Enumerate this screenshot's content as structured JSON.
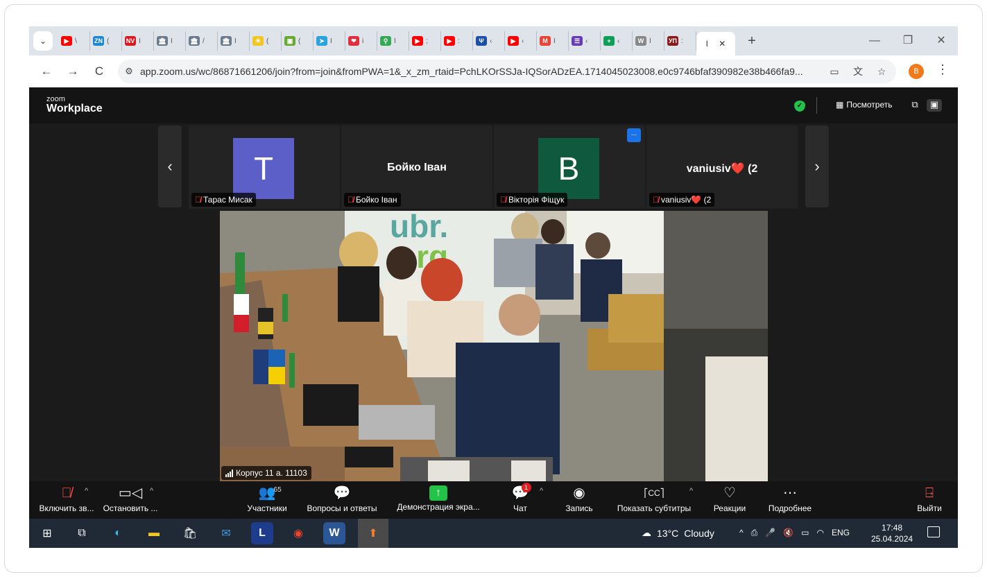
{
  "browser": {
    "tabs": [
      {
        "icon": "youtube-icon",
        "color": "#ff0000",
        "glyph": "▶",
        "text": "\\"
      },
      {
        "icon": "zn-icon",
        "color": "#1c88d4",
        "glyph": "ZN",
        "text": "("
      },
      {
        "icon": "nv-icon",
        "color": "#d71920",
        "glyph": "NV",
        "text": "I"
      },
      {
        "icon": "parliament-icon",
        "color": "#6b7b8c",
        "glyph": "🏛",
        "text": "I"
      },
      {
        "icon": "parliament-icon",
        "color": "#6b7b8c",
        "glyph": "🏛",
        "text": "/"
      },
      {
        "icon": "parliament-icon",
        "color": "#6b7b8c",
        "glyph": "🏛",
        "text": "I"
      },
      {
        "icon": "sun-icon",
        "color": "#f3c623",
        "glyph": "☀",
        "text": "("
      },
      {
        "icon": "box-icon",
        "color": "#66aa33",
        "glyph": "▣",
        "text": "("
      },
      {
        "icon": "telegram-icon",
        "color": "#2aa3de",
        "glyph": "➤",
        "text": "I"
      },
      {
        "icon": "heart-icon",
        "color": "#e03040",
        "glyph": "❤",
        "text": "i"
      },
      {
        "icon": "maps-pin-icon",
        "color": "#34a853",
        "glyph": "⚲",
        "text": "I"
      },
      {
        "icon": "youtube-icon",
        "color": "#ff0000",
        "glyph": "▶",
        "text": ";"
      },
      {
        "icon": "youtube-icon",
        "color": "#ff0000",
        "glyph": "▶",
        "text": ":"
      },
      {
        "icon": "trident-icon",
        "color": "#1e4fa8",
        "glyph": "Ψ",
        "text": "‹"
      },
      {
        "icon": "youtube-icon",
        "color": "#ff0000",
        "glyph": "▶",
        "text": "‹"
      },
      {
        "icon": "gmail-icon",
        "color": "#ea4335",
        "glyph": "M",
        "text": "I"
      },
      {
        "icon": "forms-icon",
        "color": "#673ab7",
        "glyph": "☰",
        "text": "‹"
      },
      {
        "icon": "sheets-icon",
        "color": "#0f9d58",
        "glyph": "+",
        "text": "‹"
      },
      {
        "icon": "wikipedia-icon",
        "color": "#888888",
        "glyph": "W",
        "text": "I"
      },
      {
        "icon": "vp-icon",
        "color": "#8b1a1a",
        "glyph": "УП",
        "text": ":"
      }
    ],
    "active_tab": {
      "text": "I",
      "close": "✕"
    },
    "new_tab": "+",
    "window_controls": {
      "minimize": "—",
      "restore": "❐",
      "close": "✕"
    },
    "url": "app.zoom.us/wc/86871661206/join?from=join&fromPWA=1&_x_zm_rtaid=PchLKOrSSJa-IQSorADzEA.1714045023008.e0c9746bfaf390982e38b466fa9...",
    "profile_initial": "B",
    "nav": {
      "back": "←",
      "forward": "→",
      "reload": "C"
    }
  },
  "zoom": {
    "logo_small": "zoom",
    "logo_big": "Workplace",
    "view_button": "Посмотреть",
    "participants_strip": [
      {
        "name": "Тарас Мисак",
        "avatar_letter": "T",
        "avatar_color": "#5b5fc7",
        "muted": true
      },
      {
        "name": "Бойко Іван",
        "display_name": "Бойко Іван",
        "muted": true
      },
      {
        "name": "Вікторія Фіщук",
        "avatar_letter": "B",
        "avatar_color": "#0f5a3e",
        "muted": true
      },
      {
        "name": "vaniusiv❤️ (2",
        "display_name": "vaniusiv❤️ (2",
        "muted": true
      }
    ],
    "more_badge": "...",
    "prev_arrow": "‹",
    "next_arrow": "›",
    "main_video_label": "Корпус 11 а. 11103",
    "wall_text_1": "ubr.",
    "wall_text_2": "org.",
    "toolbar": {
      "unmute": "Включить зв...",
      "stop_video": "Остановить ...",
      "participants": "Участники",
      "participants_count": "65",
      "qa": "Вопросы и ответы",
      "share": "Демонстрация экра...",
      "chat": "Чат",
      "chat_badge": "1",
      "record": "Запись",
      "captions": "Показать субтитры",
      "reactions": "Реакции",
      "more": "Подробнее",
      "leave": "Выйти"
    }
  },
  "taskbar": {
    "weather_temp": "13°C",
    "weather_text": "Cloudy",
    "language": "ENG",
    "time": "17:48",
    "date": "25.04.2024"
  }
}
